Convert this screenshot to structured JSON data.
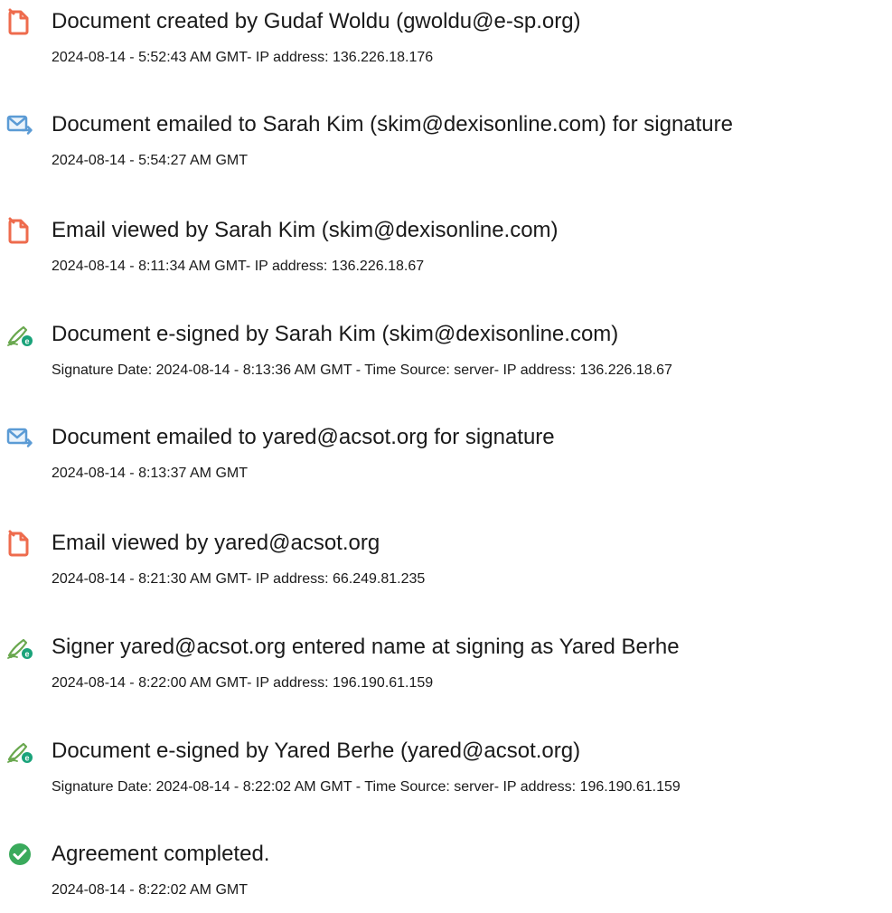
{
  "events": [
    {
      "icon": "document-created-icon",
      "title": "Document created by Gudaf Woldu (gwoldu@e-sp.org)",
      "detail": "2024-08-14 - 5:52:43 AM GMT- IP address: 136.226.18.176"
    },
    {
      "icon": "email-sent-icon",
      "title": "Document emailed to Sarah Kim (skim@dexisonline.com) for signature",
      "detail": "2024-08-14 - 5:54:27 AM GMT"
    },
    {
      "icon": "document-viewed-icon",
      "title": "Email viewed by Sarah Kim (skim@dexisonline.com)",
      "detail": "2024-08-14 - 8:11:34 AM GMT- IP address: 136.226.18.67"
    },
    {
      "icon": "e-sign-pen-icon",
      "title": "Document e-signed by Sarah Kim (skim@dexisonline.com)",
      "detail": "Signature Date: 2024-08-14 - 8:13:36 AM GMT - Time Source: server- IP address: 136.226.18.67"
    },
    {
      "icon": "email-sent-icon",
      "title": "Document emailed to yared@acsot.org for signature",
      "detail": "2024-08-14 - 8:13:37 AM GMT"
    },
    {
      "icon": "document-viewed-icon",
      "title": "Email viewed by yared@acsot.org",
      "detail": "2024-08-14 - 8:21:30 AM GMT- IP address: 66.249.81.235"
    },
    {
      "icon": "e-sign-pen-icon",
      "title": "Signer yared@acsot.org entered name at signing as Yared Berhe",
      "detail": "2024-08-14 - 8:22:00 AM GMT- IP address: 196.190.61.159"
    },
    {
      "icon": "e-sign-pen-icon",
      "title": "Document e-signed by Yared Berhe (yared@acsot.org)",
      "detail": "Signature Date: 2024-08-14 - 8:22:02 AM GMT - Time Source: server- IP address: 196.190.61.159"
    },
    {
      "icon": "checkmark-circle-icon",
      "title": "Agreement completed.",
      "detail": "2024-08-14 - 8:22:02 AM GMT"
    }
  ],
  "colors": {
    "document_icon": "#ee6b4d",
    "email_icon": "#5b9bd5",
    "sign_icon": "#6aa84f",
    "sign_badge": "#1aa37a",
    "complete_icon": "#3aaa5c",
    "text": "#1a1a1a"
  }
}
